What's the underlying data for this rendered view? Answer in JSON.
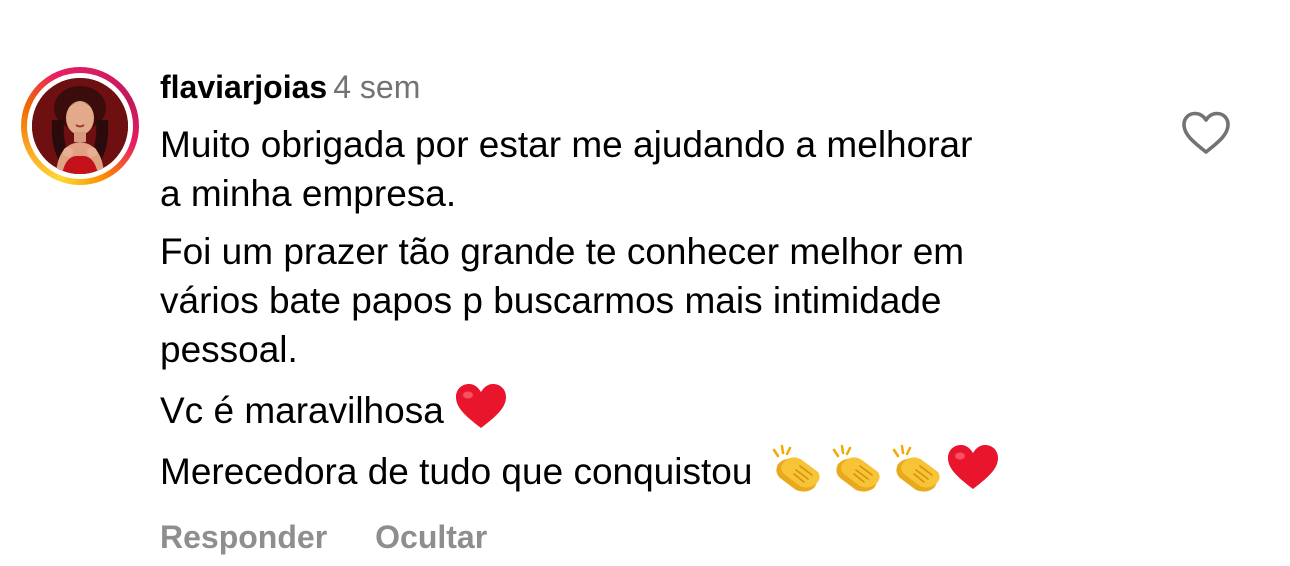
{
  "comment": {
    "username": "flaviarjoias",
    "time": "4 sem",
    "paragraphs": [
      {
        "lines": [
          "Muito obrigada por estar me ajudando a melhorar",
          "a minha empresa."
        ]
      },
      {
        "lines": [
          "Foi um prazer tão grande te conhecer melhor em",
          "vários bate papos p buscarmos mais intimidade",
          "pessoal."
        ]
      },
      {
        "lines": [
          "Vc é maravilhosa"
        ],
        "emojis": [
          "red-heart"
        ]
      },
      {
        "lines": [
          "Merecedora de tudo que conquistou"
        ],
        "emojis": [
          "clapping-hands",
          "clapping-hands",
          "clapping-hands",
          "red-heart"
        ]
      }
    ],
    "actions": {
      "reply_label": "Responder",
      "hide_label": "Ocultar"
    },
    "like_icon": "heart-outline-icon"
  },
  "colors": {
    "text": "#000000",
    "secondary_text": "#737373",
    "action_text": "#8e8e8e",
    "heart_red": "#e8152d",
    "clap_yellow": "#f7c437",
    "story_ring_start": "#fdd835",
    "story_ring_end": "#d81b60"
  }
}
